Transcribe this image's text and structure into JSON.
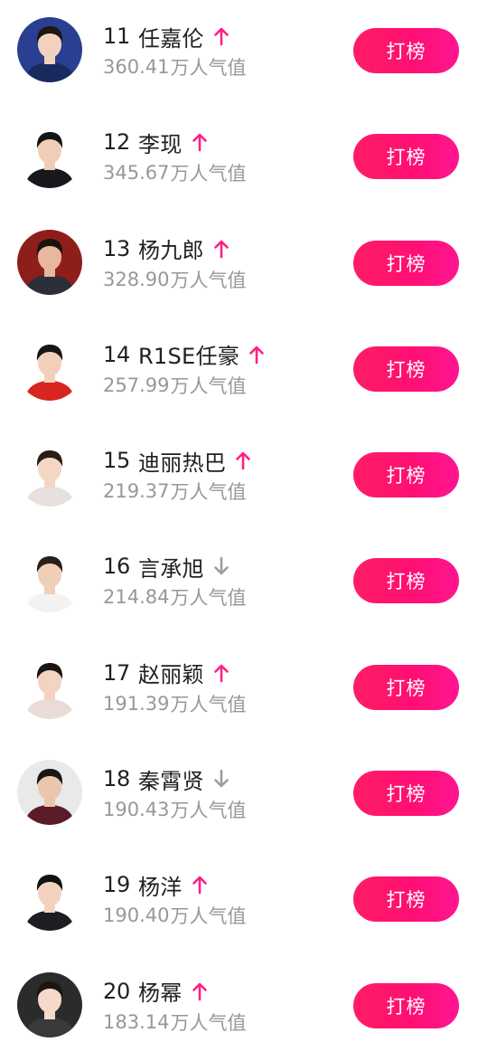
{
  "colors": {
    "accent": "#ff1468",
    "trend_up": "#ff1e87",
    "trend_down": "#9c9ca3",
    "name_text": "#1f1f24",
    "score_text": "#97979d"
  },
  "score_unit": "万人气值",
  "vote_label": "打榜",
  "rankings": [
    {
      "rank": "11",
      "name": "任嘉伦",
      "score": "360.41",
      "trend": "up",
      "avatar": {
        "bg": "#2a3f8f",
        "skin": "#f3d2bd",
        "hair": "#1d1712",
        "shirt": "#1b2a5e"
      }
    },
    {
      "rank": "12",
      "name": "李现",
      "score": "345.67",
      "trend": "up",
      "avatar": {
        "bg": "#ffffff",
        "skin": "#f0cdb6",
        "hair": "#141414",
        "shirt": "#18181c"
      }
    },
    {
      "rank": "13",
      "name": "杨九郎",
      "score": "328.90",
      "trend": "up",
      "avatar": {
        "bg": "#8e1e1a",
        "skin": "#e7b89d",
        "hair": "#1a1210",
        "shirt": "#2b2f3a"
      }
    },
    {
      "rank": "14",
      "name": "R1SE任豪",
      "score": "257.99",
      "trend": "up",
      "avatar": {
        "bg": "#ffffff",
        "skin": "#f2d0bb",
        "hair": "#161616",
        "shirt": "#d8251f"
      }
    },
    {
      "rank": "15",
      "name": "迪丽热巴",
      "score": "219.37",
      "trend": "up",
      "avatar": {
        "bg": "#ffffff",
        "skin": "#f4d6c4",
        "hair": "#2a1c17",
        "shirt": "#e6e1de"
      }
    },
    {
      "rank": "16",
      "name": "言承旭",
      "score": "214.84",
      "trend": "down",
      "avatar": {
        "bg": "#ffffff",
        "skin": "#efcfb7",
        "hair": "#2a1e18",
        "shirt": "#f2f2f2"
      }
    },
    {
      "rank": "17",
      "name": "赵丽颖",
      "score": "191.39",
      "trend": "up",
      "avatar": {
        "bg": "#ffffff",
        "skin": "#f3d4c2",
        "hair": "#1a1412",
        "shirt": "#e9dcd6"
      }
    },
    {
      "rank": "18",
      "name": "秦霄贤",
      "score": "190.43",
      "trend": "down",
      "avatar": {
        "bg": "#e9e9e9",
        "skin": "#eac6ad",
        "hair": "#1a1614",
        "shirt": "#5a1b2a"
      }
    },
    {
      "rank": "19",
      "name": "杨洋",
      "score": "190.40",
      "trend": "up",
      "avatar": {
        "bg": "#ffffff",
        "skin": "#f3d3c0",
        "hair": "#121212",
        "shirt": "#1d1d22"
      }
    },
    {
      "rank": "20",
      "name": "杨幂",
      "score": "183.14",
      "trend": "up",
      "avatar": {
        "bg": "#2b2b2b",
        "skin": "#f5dacb",
        "hair": "#1c1512",
        "shirt": "#3a3a3a"
      }
    }
  ]
}
